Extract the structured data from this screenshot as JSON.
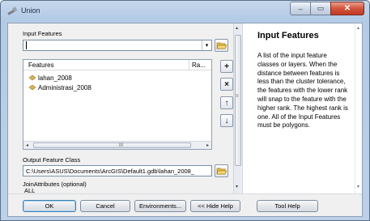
{
  "window": {
    "title": "Union",
    "minimize_glyph": "–",
    "maximize_glyph": "▭",
    "close_glyph": "✕"
  },
  "form": {
    "input_features_label": "Input Features",
    "input_features_value": "",
    "dropdown_glyph": "▾",
    "table": {
      "col_features": "Features",
      "col_ranks": "Ra...",
      "rows": [
        {
          "name": "lahan_2008"
        },
        {
          "name": "Administrasi_2008"
        }
      ],
      "scroll_left": "◂",
      "scroll_right": "▸",
      "scroll_grip": "III"
    },
    "add_glyph": "+",
    "remove_glyph": "×",
    "up_glyph": "↑",
    "down_glyph": "↓",
    "output_label": "Output Feature Class",
    "output_value": "C:\\Users\\ASUS\\Documents\\ArcGIS\\Default1.gdb\\lahan_2008_",
    "join_label": "JoinAttributes (optional)",
    "join_value_partial": "ALL",
    "vscroll_up": "▴",
    "vscroll_down": "▾",
    "vscroll_grip": "≡"
  },
  "help": {
    "title": "Input Features",
    "body": "A list of the input feature classes or layers. When the distance between features is less than the cluster tolerance, the features with the lower rank will snap to the feature with the higher rank. The highest rank is one. All of the Input Features must be polygons.",
    "scroll_up": "▴",
    "scroll_down": "▾"
  },
  "buttons": {
    "ok": "OK",
    "cancel": "Cancel",
    "environments": "Environments...",
    "hide_help": "<< Hide Help",
    "tool_help": "Tool Help"
  },
  "colors": {
    "title_bar": "#b4cbe6",
    "close_button": "#d1533b",
    "feature_icon": "#d9b45a",
    "folder_icon": "#e8c04a"
  }
}
